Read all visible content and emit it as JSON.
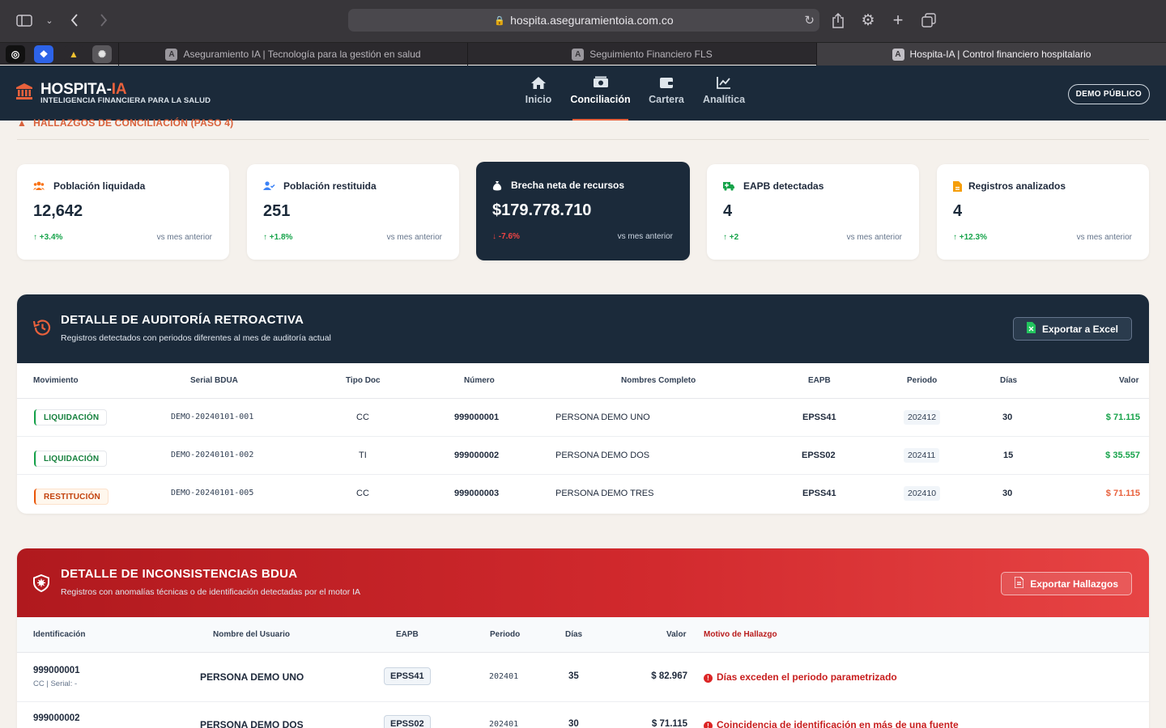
{
  "browser": {
    "url": "hospita.aseguramientoia.com.co",
    "tabs": [
      {
        "label": "Aseguramiento IA | Tecnología para la gestión en salud",
        "favicon": "A"
      },
      {
        "label": "Seguimiento Financiero FLS",
        "favicon": "A"
      },
      {
        "label": "Hospita-IA | Control financiero hospitalario",
        "favicon": "A"
      }
    ]
  },
  "brand": {
    "title_main": "HOSPITA-",
    "title_accent": "IA",
    "subtitle": "INTELIGENCIA FINANCIERA PARA LA SALUD",
    "accent_color": "#e8613c"
  },
  "nav": {
    "items": [
      {
        "label": "Inicio",
        "icon": "home-icon"
      },
      {
        "label": "Conciliación",
        "icon": "money-icon"
      },
      {
        "label": "Cartera",
        "icon": "wallet-icon"
      },
      {
        "label": "Analítica",
        "icon": "chart-line-icon"
      }
    ],
    "active": "Conciliación",
    "demo_label": "DEMO PÚBLICO"
  },
  "section": {
    "heading": "HALLAZGOS DE CONCILIACIÓN (PASO 4)"
  },
  "kpis": [
    {
      "label": "Población liquidada",
      "value": "12,642",
      "delta": "+3.4%",
      "compare": "vs mes anterior",
      "icon": "users-icon"
    },
    {
      "label": "Población restituida",
      "value": "251",
      "delta": "+1.8%",
      "compare": "vs mes anterior",
      "icon": "user-check-icon"
    },
    {
      "label": "Brecha neta de recursos",
      "value": "$179.778.710",
      "delta": "-7.6%",
      "compare": "vs mes anterior",
      "icon": "money-bag-icon"
    },
    {
      "label": "EAPB detectadas",
      "value": "4",
      "delta": "+2",
      "compare": "vs mes anterior",
      "icon": "truck-medical-icon"
    },
    {
      "label": "Registros analizados",
      "value": "4",
      "delta": "+12.3%",
      "compare": "vs mes anterior",
      "icon": "file-icon"
    }
  ],
  "retro": {
    "title": "DETALLE DE AUDITORÍA RETROACTIVA",
    "subtitle": "Registros detectados con periodos diferentes al mes de auditoría actual",
    "export_label": "Exportar a Excel",
    "columns": [
      "Movimiento",
      "Serial BDUA",
      "Tipo Doc",
      "Número",
      "Nombres Completo",
      "EAPB",
      "Periodo",
      "Días",
      "Valor"
    ],
    "rows": [
      {
        "movimiento": "LIQUIDACIÓN",
        "serial": "DEMO-20240101-001",
        "tipo_doc": "CC",
        "numero": "999000001",
        "nombre": "PERSONA DEMO UNO",
        "eapb": "EPSS41",
        "periodo": "202412",
        "dias": "30",
        "valor": "$ 71.115"
      },
      {
        "movimiento": "LIQUIDACIÓN",
        "serial": "DEMO-20240101-002",
        "tipo_doc": "TI",
        "numero": "999000002",
        "nombre": "PERSONA DEMO DOS",
        "eapb": "EPSS02",
        "periodo": "202411",
        "dias": "15",
        "valor": "$ 35.557"
      },
      {
        "movimiento": "RESTITUCIÓN",
        "serial": "DEMO-20240101-005",
        "tipo_doc": "CC",
        "numero": "999000003",
        "nombre": "PERSONA DEMO TRES",
        "eapb": "EPSS41",
        "periodo": "202410",
        "dias": "30",
        "valor": "$ 71.115"
      }
    ]
  },
  "bdua": {
    "title": "DETALLE DE INCONSISTENCIAS BDUA",
    "subtitle": "Registros con anomalías técnicas o de identificación detectadas por el motor IA",
    "export_label": "Exportar Hallazgos",
    "columns": [
      "Identificación",
      "Nombre del Usuario",
      "EAPB",
      "Periodo",
      "Días",
      "Valor",
      "Motivo de Hallazgo"
    ],
    "rows": [
      {
        "id": "999000001",
        "id_sub": "CC | Serial: -",
        "nombre": "PERSONA DEMO UNO",
        "eapb": "EPSS41",
        "periodo": "202401",
        "dias": "35",
        "valor": "$ 82.967",
        "motivo": "Días exceden el periodo parametrizado"
      },
      {
        "id": "999000002",
        "id_sub": "",
        "nombre": "PERSONA DEMO DOS",
        "eapb": "EPSS02",
        "periodo": "202401",
        "dias": "30",
        "valor": "$ 71.115",
        "motivo": "Coincidencia de identificación en más de una fuente"
      }
    ]
  }
}
